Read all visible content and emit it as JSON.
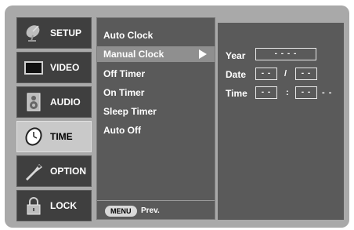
{
  "nav": [
    {
      "label": "SETUP",
      "icon": "satellite-dish-icon"
    },
    {
      "label": "VIDEO",
      "icon": "tv-screen-icon"
    },
    {
      "label": "AUDIO",
      "icon": "speaker-icon"
    },
    {
      "label": "TIME",
      "icon": "clock-icon"
    },
    {
      "label": "OPTION",
      "icon": "tag-icon"
    },
    {
      "label": "LOCK",
      "icon": "padlock-icon"
    }
  ],
  "selected_nav": "TIME",
  "menu": {
    "items": [
      "Auto Clock",
      "Manual Clock",
      "Off Timer",
      "On Timer",
      "Sleep Timer",
      "Auto Off"
    ],
    "active": "Manual Clock",
    "footer": {
      "key": "MENU",
      "action": "Prev."
    }
  },
  "settings": {
    "year_label": "Year",
    "year_value": "- - - -",
    "date_label": "Date",
    "month_value": "- -",
    "date_sep": "/",
    "day_value": "- -",
    "time_label": "Time",
    "hour_value": "- -",
    "time_sep": ":",
    "minute_value": "- -",
    "ampm_value": "- -"
  },
  "colors": {
    "panel": "#5a5a5a",
    "highlight": "#8f8f8f",
    "frame": "#a9a9a9",
    "selected_nav": "#c9c9c9"
  }
}
